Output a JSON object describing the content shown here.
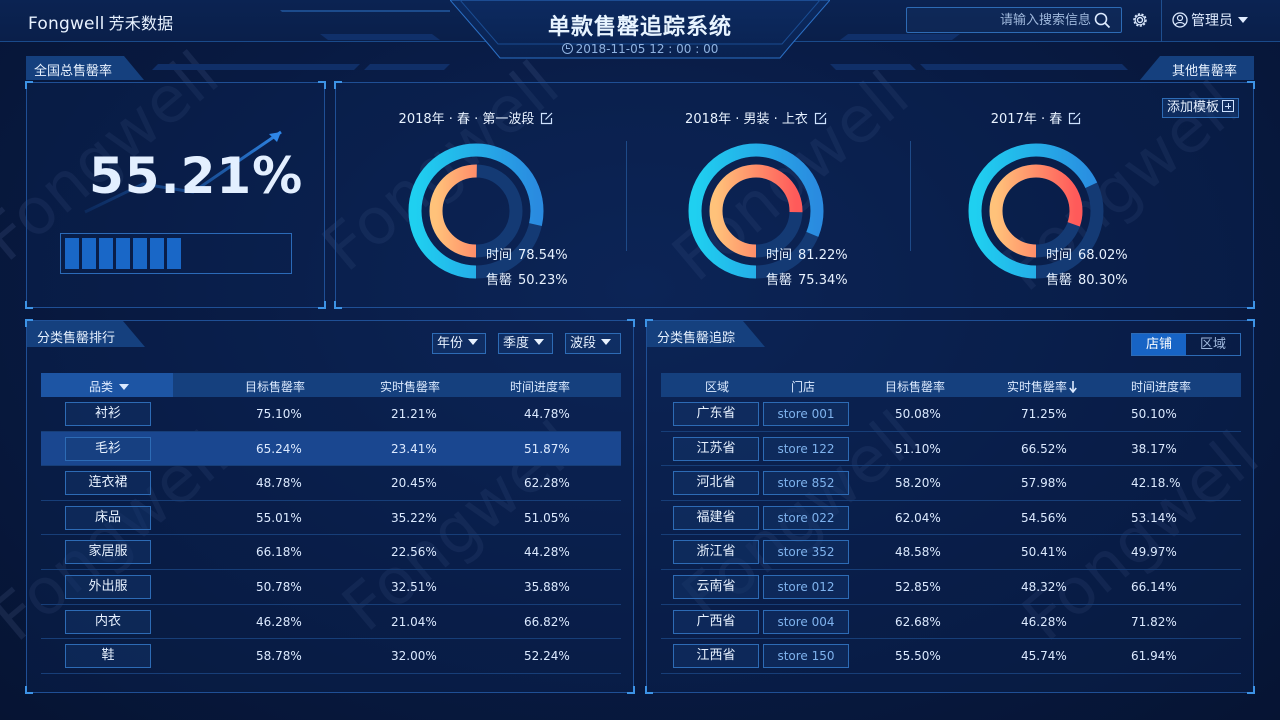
{
  "header": {
    "logo_en": "Fongwell",
    "logo_cn": "芳禾数据",
    "title": "单款售罄追踪系统",
    "datetime": "2018-11-05 12 : 00 : 00",
    "search_placeholder": "请输入搜索信息",
    "user_label": "管理员"
  },
  "watermark": "Fongwell",
  "national": {
    "tab_label": "全国总售罄率",
    "rate_text": "55.21%",
    "rate_value": 0.5521
  },
  "other": {
    "tab_label": "其他售罄率",
    "add_template_label": "添加模板",
    "time_label": "时间",
    "sell_label": "售罄",
    "donuts": [
      {
        "title": "2018年 · 春 · 第一波段",
        "time_text": "78.54%",
        "time_value": 0.7854,
        "sell_text": "50.23%",
        "sell_value": 0.5023
      },
      {
        "title": "2018年 · 男装 · 上衣",
        "time_text": "81.22%",
        "time_value": 0.8122,
        "sell_text": "75.34%",
        "sell_value": 0.7534
      },
      {
        "title": "2017年 · 春",
        "time_text": "68.02%",
        "time_value": 0.6802,
        "sell_text": "80.30%",
        "sell_value": 0.803
      }
    ]
  },
  "rank": {
    "title": "分类售罄排行",
    "filters": [
      "年份",
      "季度",
      "波段"
    ],
    "columns": [
      "品类",
      "目标售罄率",
      "实时售罄率",
      "时间进度率"
    ],
    "rows": [
      [
        "衬衫",
        "75.10%",
        "21.21%",
        "44.78%"
      ],
      [
        "毛衫",
        "65.24%",
        "23.41%",
        "51.87%"
      ],
      [
        "连衣裙",
        "48.78%",
        "20.45%",
        "62.28%"
      ],
      [
        "床品",
        "55.01%",
        "35.22%",
        "51.05%"
      ],
      [
        "家居服",
        "66.18%",
        "22.56%",
        "44.28%"
      ],
      [
        "外出服",
        "50.78%",
        "32.51%",
        "35.88%"
      ],
      [
        "内衣",
        "46.28%",
        "21.04%",
        "66.82%"
      ],
      [
        "鞋",
        "58.78%",
        "32.00%",
        "52.24%"
      ]
    ],
    "selected_index": 1
  },
  "track": {
    "title": "分类售罄追踪",
    "toggle": [
      "店铺",
      "区域"
    ],
    "toggle_active": 0,
    "columns": [
      "区域",
      "门店",
      "目标售罄率",
      "实时售罄率",
      "时间进度率"
    ],
    "rows": [
      [
        "广东省",
        "store 001",
        "50.08%",
        "71.25%",
        "50.10%"
      ],
      [
        "江苏省",
        "store 122",
        "51.10%",
        "66.52%",
        "38.17%"
      ],
      [
        "河北省",
        "store 852",
        "58.20%",
        "57.98%",
        "42.18.%"
      ],
      [
        "福建省",
        "store 022",
        "62.04%",
        "54.56%",
        "53.14%"
      ],
      [
        "浙江省",
        "store 352",
        "48.58%",
        "50.41%",
        "49.97%"
      ],
      [
        "云南省",
        "store 012",
        "52.85%",
        "48.32%",
        "66.14%"
      ],
      [
        "广西省",
        "store 004",
        "62.68%",
        "46.28%",
        "71.82%"
      ],
      [
        "江西省",
        "store 150",
        "55.50%",
        "45.74%",
        "61.94%"
      ]
    ]
  },
  "colors": {
    "accent": "#1764c5",
    "inner_ring_start": "#ff5a5a",
    "inner_ring_end": "#ffc27a",
    "outer_ring_start": "#2a8be0",
    "outer_ring_end": "#1fd0f0"
  }
}
